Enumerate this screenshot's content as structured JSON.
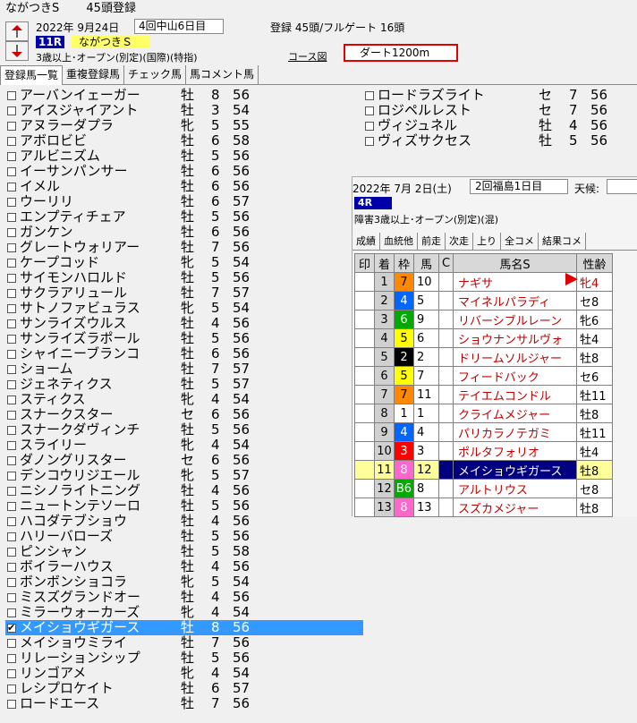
{
  "window": {
    "title": "ながつきS",
    "subtitle": "45頭登録"
  },
  "header": {
    "date": "2022年 9月24日",
    "meeting": "4回中山6日目",
    "registration": "登録 45頭/フルゲート 16頭",
    "race_number": "11R",
    "race_name": "ながつきＳ",
    "conditions": "3歳以上･オープン(別定)(国際)(特指)",
    "course_label": "コース図",
    "course": "ダート1200m"
  },
  "tabs": [
    "登録馬一覧",
    "重複登録馬",
    "チェック馬",
    "馬コメント馬"
  ],
  "horses_left": [
    {
      "name": "アーバンイェーガー",
      "sex": "牡",
      "age": "8",
      "weight": "56"
    },
    {
      "name": "アイスジャイアント",
      "sex": "牡",
      "age": "3",
      "weight": "54"
    },
    {
      "name": "アヌラーダプラ",
      "sex": "牝",
      "age": "5",
      "weight": "55"
    },
    {
      "name": "アボロビビ",
      "sex": "牡",
      "age": "6",
      "weight": "58"
    },
    {
      "name": "アルビニズム",
      "sex": "牡",
      "age": "5",
      "weight": "56"
    },
    {
      "name": "イーサンパンサー",
      "sex": "牡",
      "age": "6",
      "weight": "56"
    },
    {
      "name": "イメル",
      "sex": "牡",
      "age": "6",
      "weight": "56"
    },
    {
      "name": "ウーリリ",
      "sex": "牡",
      "age": "6",
      "weight": "57"
    },
    {
      "name": "エンプティチェア",
      "sex": "牡",
      "age": "5",
      "weight": "56"
    },
    {
      "name": "ガンケン",
      "sex": "牡",
      "age": "6",
      "weight": "56"
    },
    {
      "name": "グレートウォリアー",
      "sex": "牡",
      "age": "7",
      "weight": "56"
    },
    {
      "name": "ケープコッド",
      "sex": "牝",
      "age": "5",
      "weight": "54"
    },
    {
      "name": "サイモンハロルド",
      "sex": "牡",
      "age": "5",
      "weight": "56"
    },
    {
      "name": "サクラアリュール",
      "sex": "牡",
      "age": "7",
      "weight": "57"
    },
    {
      "name": "サトノファビュラス",
      "sex": "牝",
      "age": "5",
      "weight": "54"
    },
    {
      "name": "サンライズウルス",
      "sex": "牡",
      "age": "4",
      "weight": "56"
    },
    {
      "name": "サンライズラポール",
      "sex": "牡",
      "age": "5",
      "weight": "56"
    },
    {
      "name": "シャイニーブランコ",
      "sex": "牡",
      "age": "6",
      "weight": "56"
    },
    {
      "name": "ショーム",
      "sex": "牡",
      "age": "7",
      "weight": "57"
    },
    {
      "name": "ジェネティクス",
      "sex": "牡",
      "age": "5",
      "weight": "57"
    },
    {
      "name": "スティクス",
      "sex": "牝",
      "age": "4",
      "weight": "54"
    },
    {
      "name": "スナークスター",
      "sex": "セ",
      "age": "6",
      "weight": "56"
    },
    {
      "name": "スナークダヴィンチ",
      "sex": "牡",
      "age": "5",
      "weight": "56"
    },
    {
      "name": "スライリー",
      "sex": "牝",
      "age": "4",
      "weight": "54"
    },
    {
      "name": "ダノングリスター",
      "sex": "セ",
      "age": "6",
      "weight": "56"
    },
    {
      "name": "デンコウリジエール",
      "sex": "牝",
      "age": "5",
      "weight": "57"
    },
    {
      "name": "ニシノライトニング",
      "sex": "牡",
      "age": "4",
      "weight": "56"
    },
    {
      "name": "ニュートンテソーロ",
      "sex": "牡",
      "age": "5",
      "weight": "56"
    },
    {
      "name": "ハコダテブショウ",
      "sex": "牡",
      "age": "4",
      "weight": "56"
    },
    {
      "name": "ハリーバローズ",
      "sex": "牡",
      "age": "5",
      "weight": "56"
    },
    {
      "name": "ピンシャン",
      "sex": "牡",
      "age": "5",
      "weight": "58"
    },
    {
      "name": "ボイラーハウス",
      "sex": "牡",
      "age": "4",
      "weight": "56"
    },
    {
      "name": "ボンボンショコラ",
      "sex": "牝",
      "age": "5",
      "weight": "54"
    },
    {
      "name": "ミスズグランドオー",
      "sex": "牡",
      "age": "4",
      "weight": "56"
    },
    {
      "name": "ミラーウォーカーズ",
      "sex": "牝",
      "age": "4",
      "weight": "54"
    },
    {
      "name": "メイショウギガース",
      "sex": "牡",
      "age": "8",
      "weight": "56"
    },
    {
      "name": "メイショウミライ",
      "sex": "牡",
      "age": "7",
      "weight": "56"
    },
    {
      "name": "リレーションシップ",
      "sex": "牡",
      "age": "5",
      "weight": "56"
    },
    {
      "name": "リンゴアメ",
      "sex": "牝",
      "age": "4",
      "weight": "54"
    },
    {
      "name": "レシプロケイト",
      "sex": "牡",
      "age": "6",
      "weight": "57"
    },
    {
      "name": "ロードエース",
      "sex": "牡",
      "age": "7",
      "weight": "56"
    }
  ],
  "horses_right": [
    {
      "name": "ロードラズライト",
      "sex": "セ",
      "age": "7",
      "weight": "56"
    },
    {
      "name": "ロジペルレスト",
      "sex": "セ",
      "age": "7",
      "weight": "56"
    },
    {
      "name": "ヴィジュネル",
      "sex": "牡",
      "age": "4",
      "weight": "56"
    },
    {
      "name": "ヴィズサクセス",
      "sex": "牡",
      "age": "5",
      "weight": "56"
    }
  ],
  "panel": {
    "date": "2022年 7月 2日(土)",
    "meeting": "2回福島1日目",
    "weather_label": "天候:",
    "race_number": "4R",
    "conditions": "障害3歳以上･オープン(別定)(混)",
    "tabs": [
      "成績",
      "血統他",
      "前走",
      "次走",
      "上り",
      "全コメ",
      "結果コメ"
    ],
    "headers": [
      "印",
      "着",
      "枠",
      "馬",
      "C",
      "馬名S",
      "性齢"
    ],
    "results": [
      {
        "chakujun": "1",
        "waku": "7",
        "uma": "10",
        "name": "ナギサ",
        "sexage": "牝4"
      },
      {
        "chakujun": "2",
        "waku": "4",
        "uma": "5",
        "name": "マイネルパラディ",
        "sexage": "セ8"
      },
      {
        "chakujun": "3",
        "waku": "6",
        "uma": "9",
        "name": "リバーシブルレーン",
        "sexage": "牝6"
      },
      {
        "chakujun": "4",
        "waku": "5",
        "uma": "6",
        "name": "ショウナンサルヴォ",
        "sexage": "牡4"
      },
      {
        "chakujun": "5",
        "waku": "2",
        "uma": "2",
        "name": "ドリームソルジャー",
        "sexage": "牡8"
      },
      {
        "chakujun": "6",
        "waku": "5",
        "uma": "7",
        "name": "フィードバック",
        "sexage": "セ6"
      },
      {
        "chakujun": "7",
        "waku": "7",
        "uma": "11",
        "name": "テイエムコンドル",
        "sexage": "牡11"
      },
      {
        "chakujun": "8",
        "waku": "1",
        "uma": "1",
        "name": "クライムメジャー",
        "sexage": "牡8"
      },
      {
        "chakujun": "9",
        "waku": "4",
        "uma": "4",
        "name": "パリカラノテガミ",
        "sexage": "牡11"
      },
      {
        "chakujun": "10",
        "waku": "3",
        "uma": "3",
        "name": "ポルタフォリオ",
        "sexage": "牡4"
      },
      {
        "chakujun": "11",
        "waku": "8",
        "uma": "12",
        "name": "メイショウギガース",
        "sexage": "牡8"
      },
      {
        "chakujun": "12",
        "waku": "B6",
        "uma": "8",
        "name": "アルトリウス",
        "sexage": "セ8"
      },
      {
        "chakujun": "13",
        "waku": "8",
        "uma": "13",
        "name": "スズカメジャー",
        "sexage": "牡8"
      }
    ]
  },
  "colors": {
    "selection": "#3399ff",
    "race_badge": "#000080",
    "highlight": "#ffff99",
    "name_red": "#c00000",
    "course_border": "#e00000",
    "waku": {
      "1": {
        "bg": "#ffffff",
        "fg": "#000000"
      },
      "2": {
        "bg": "#000000",
        "fg": "#ffffff"
      },
      "3": {
        "bg": "#ff0000",
        "fg": "#ffffff"
      },
      "4": {
        "bg": "#0066ff",
        "fg": "#ffffff"
      },
      "5": {
        "bg": "#ffff00",
        "fg": "#000000"
      },
      "6": {
        "bg": "#00aa00",
        "fg": "#ffffff"
      },
      "7": {
        "bg": "#ff8800",
        "fg": "#000000"
      },
      "8": {
        "bg": "#ff66cc",
        "fg": "#ffffff"
      },
      "B6": {
        "bg": "#00aa00",
        "fg": "#ffffff"
      }
    }
  },
  "state": {
    "selected_horse": "メイショウギガース",
    "checked_horse": "メイショウギガース",
    "selected_result_row": 10
  }
}
